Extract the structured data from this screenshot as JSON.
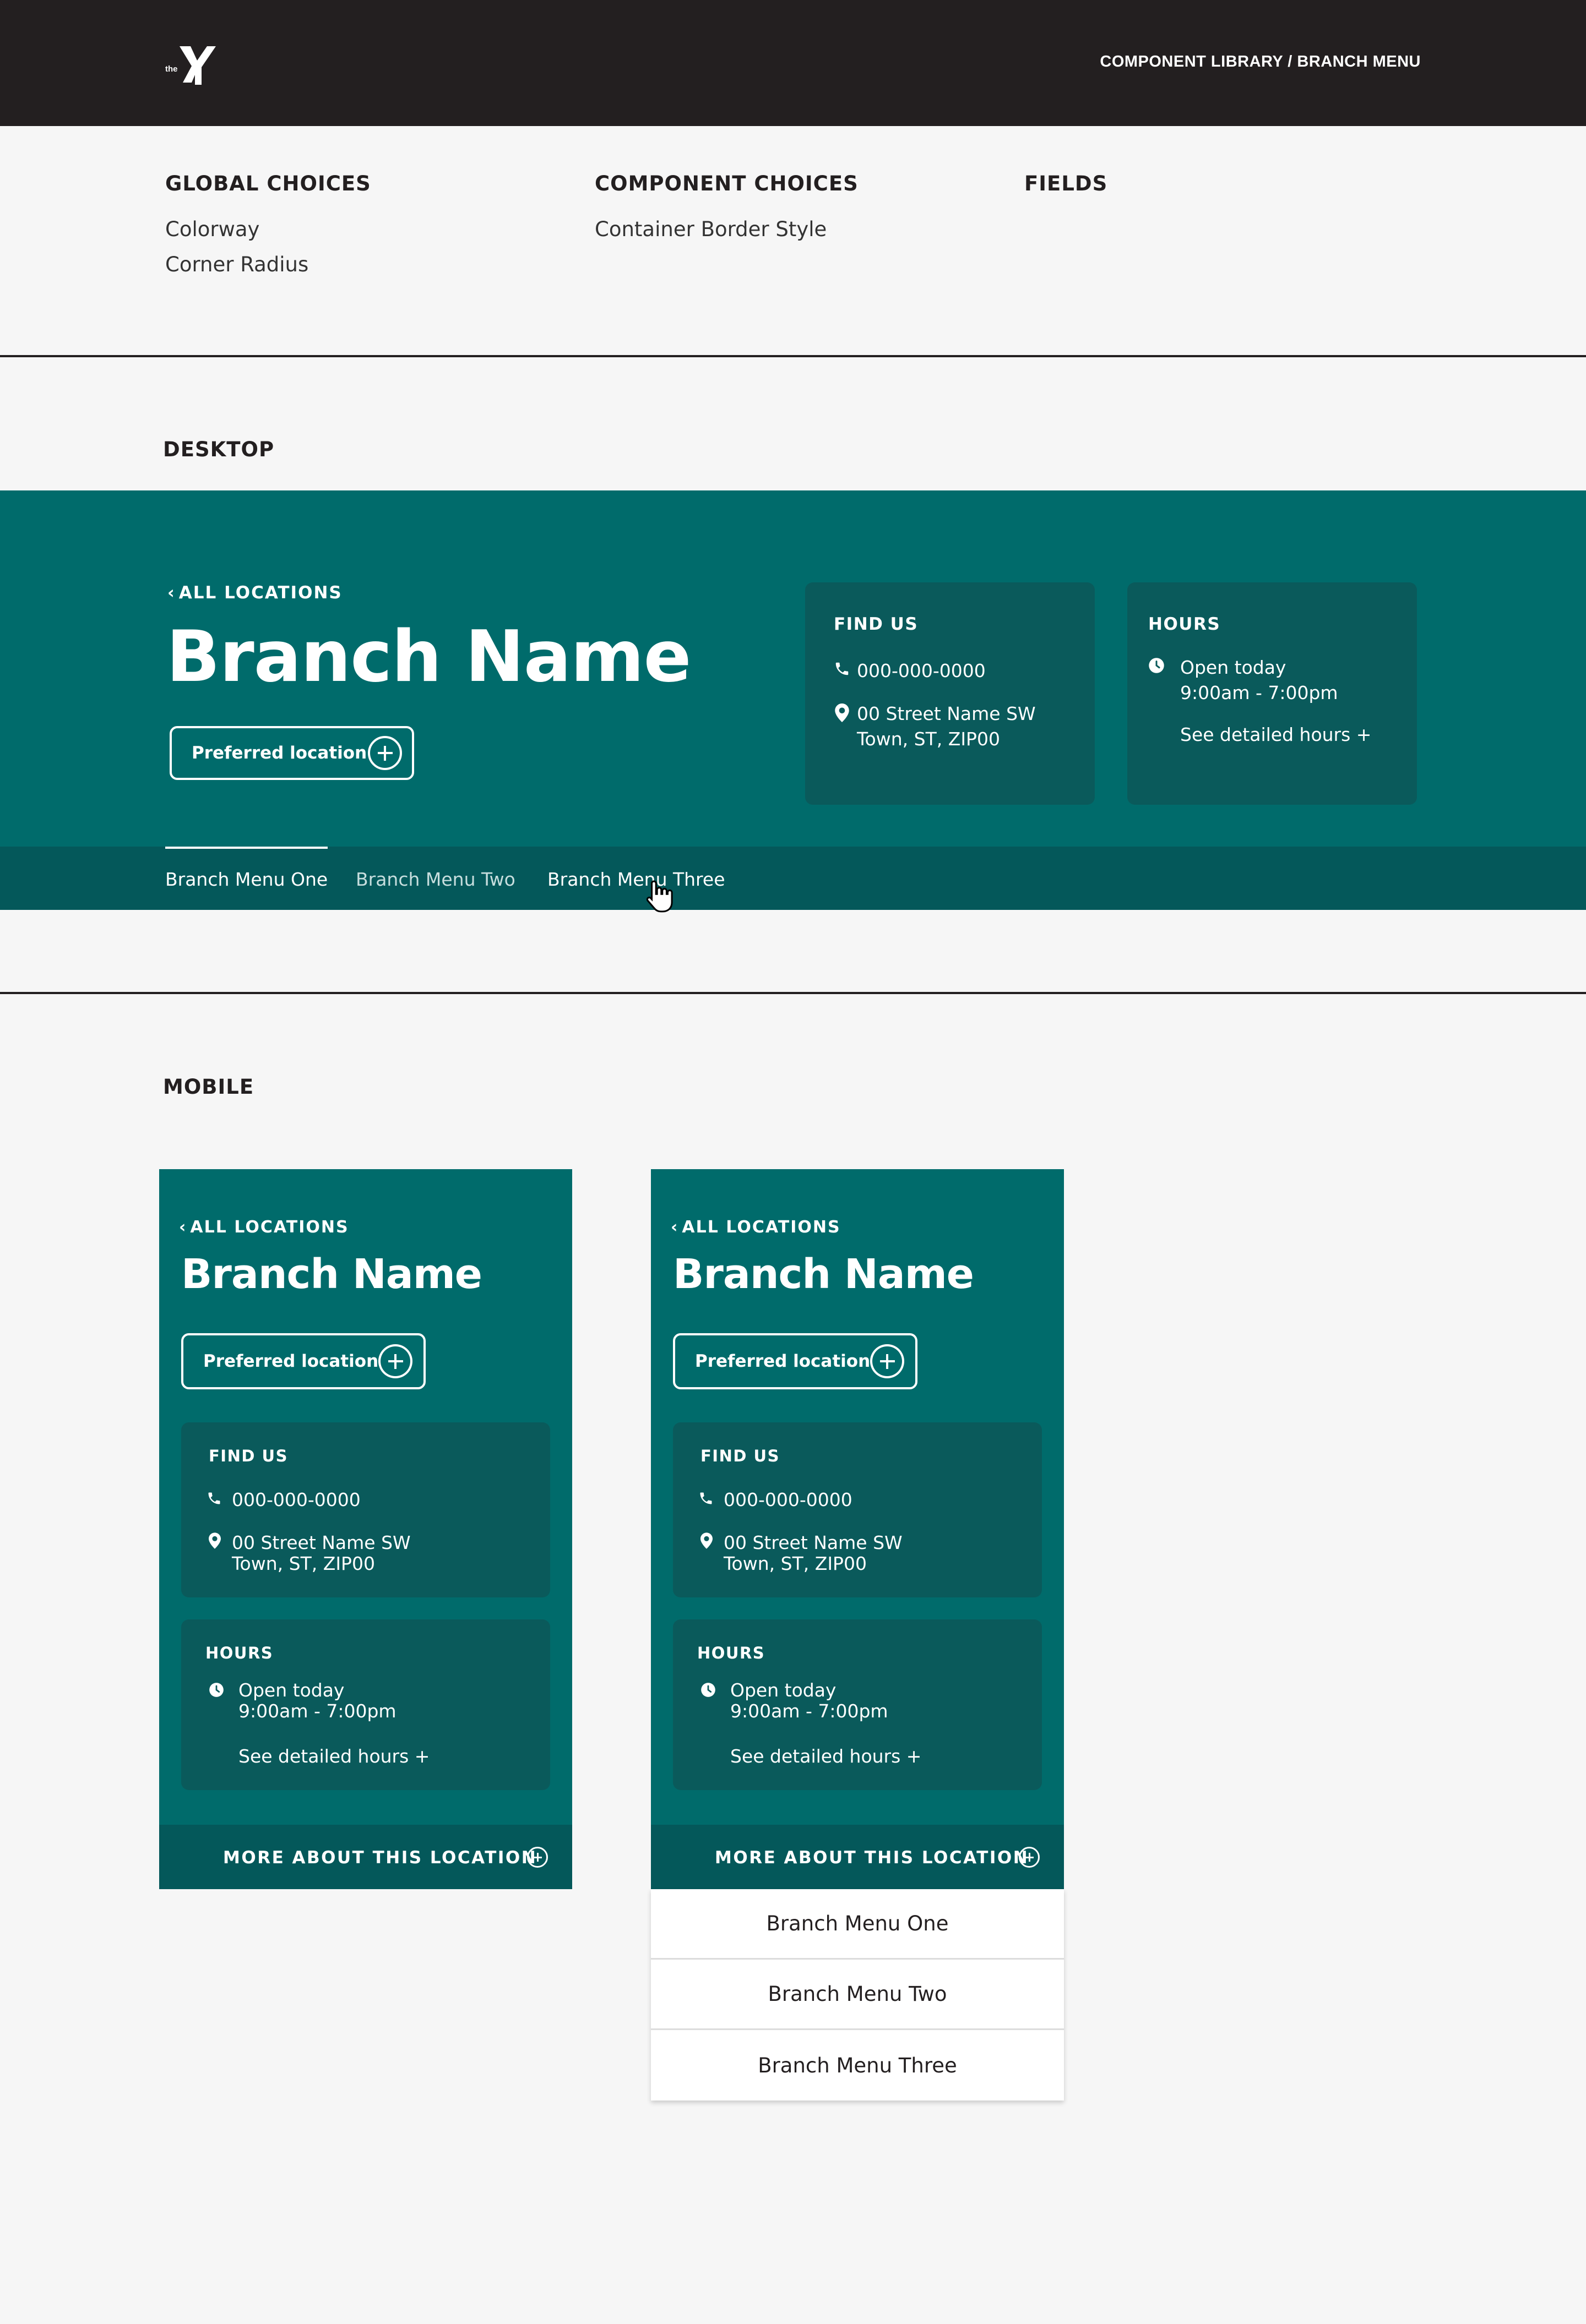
{
  "header": {
    "breadcrumb": "COMPONENT LIBRARY  / BRANCH MENU",
    "logo_text": "the Y"
  },
  "choices": {
    "global": {
      "title": "GLOBAL CHOICES",
      "items": [
        "Colorway",
        "Corner Radius"
      ]
    },
    "component": {
      "title": "COMPONENT CHOICES",
      "items": [
        "Container Border Style"
      ]
    },
    "fields": {
      "title": "FIELDS"
    }
  },
  "sections": {
    "desktop": "DESKTOP",
    "mobile": "MOBILE"
  },
  "branch": {
    "back_label": "ALL LOCATIONS",
    "name": "Branch Name",
    "preferred_label": "Preferred location",
    "find_us": {
      "title": "FIND US",
      "phone": "000-000-0000",
      "address_line1": "00 Street Name SW",
      "address_line2": "Town, ST, ZIP00"
    },
    "hours": {
      "title": "HOURS",
      "status": "Open today",
      "time": "9:00am - 7:00pm",
      "detail_link": "See detailed hours +"
    }
  },
  "menu": {
    "items": [
      "Branch Menu One",
      "Branch Menu Two",
      "Branch Menu Three"
    ],
    "active_index": 0,
    "more_label": "MORE ABOUT THIS LOCATION"
  },
  "colors": {
    "topbar": "#231f20",
    "teal": "#006b6b",
    "teal_dark": "#04585a",
    "card": "#0a5a5b",
    "page_bg": "#f6f6f6"
  },
  "icons": [
    "y-logo-icon",
    "chevron-left-icon",
    "plus-circle-icon",
    "phone-icon",
    "location-pin-icon",
    "clock-icon",
    "hand-cursor-icon"
  ]
}
